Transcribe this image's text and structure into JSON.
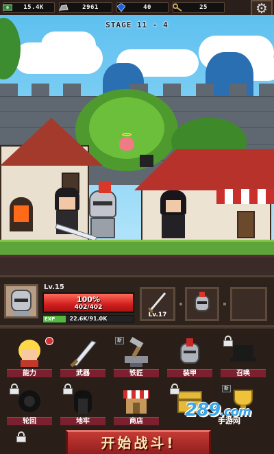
{
  "resources": [
    {
      "icon": "cash-icon",
      "value": "15.4K"
    },
    {
      "icon": "ore-icon",
      "value": "2961"
    },
    {
      "icon": "gem-icon",
      "value": "40"
    },
    {
      "icon": "key-icon",
      "value": "25"
    }
  ],
  "stage": "STAGE 11 - 4",
  "hero": {
    "level": "Lv.15",
    "hp_percent_text": "100%",
    "hp_value": "402/402",
    "hp_fraction": 1.0,
    "exp_tag": "EXP",
    "exp_value": "22.6K/91.0K",
    "exp_fraction": 0.25
  },
  "weapon_slot": {
    "level": "Lv.17"
  },
  "menu": [
    {
      "label": "能力",
      "icon": "hero-ability-icon",
      "locked": false,
      "new": true
    },
    {
      "label": "武器",
      "icon": "sword-icon",
      "locked": false,
      "new": false
    },
    {
      "label": "铁匠",
      "icon": "blacksmith-icon",
      "locked": false,
      "new": false,
      "badge": "新"
    },
    {
      "label": "装甲",
      "icon": "armor-icon",
      "locked": false,
      "new": false
    },
    {
      "label": "召唤",
      "icon": "summon-icon",
      "locked": true,
      "new": false
    },
    {
      "label": "轮回",
      "icon": "rebirth-icon",
      "locked": true,
      "new": false
    },
    {
      "label": "地牢",
      "icon": "dungeon-icon",
      "locked": true,
      "new": false
    },
    {
      "label": "商店",
      "icon": "shop-icon",
      "locked": false,
      "new": false
    },
    {
      "label": "",
      "icon": "treasure-icon",
      "locked": true,
      "new": false
    },
    {
      "label": "",
      "icon": "trophy-icon",
      "locked": false,
      "new": false,
      "badge": "新"
    }
  ],
  "start_button": "开始战斗!",
  "watermark": {
    "number": "289",
    "domain": ".com",
    "sub": "手游网"
  },
  "colors": {
    "hp": "#d21f1f",
    "exp": "#54b840",
    "ribbon": "#7c2030",
    "sky": "#5ec0ef"
  }
}
